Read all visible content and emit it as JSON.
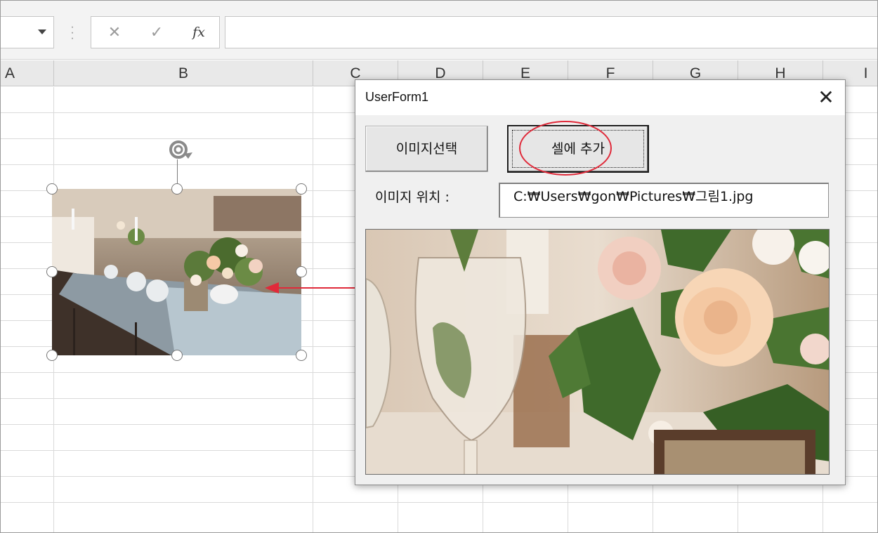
{
  "formula_bar": {
    "cancel_icon": "close-icon",
    "enter_icon": "check-icon",
    "fx_label": "fx",
    "formula_value": ""
  },
  "columns": [
    "A",
    "B",
    "C",
    "D",
    "E",
    "F",
    "G",
    "H",
    "I"
  ],
  "sheet_picture": {
    "icon": "image"
  },
  "userform": {
    "title": "UserForm1",
    "close_label": "✕",
    "select_button_label": "이미지선택",
    "add_button_label": "셀에 추가",
    "path_label": "이미지 위치 :",
    "path_value": "C:₩Users₩gon₩Pictures₩그림1.jpg"
  },
  "colors": {
    "annotation_red": "#e02a3a",
    "grid_line": "#dadada",
    "header_bg": "#e9e9e9"
  }
}
